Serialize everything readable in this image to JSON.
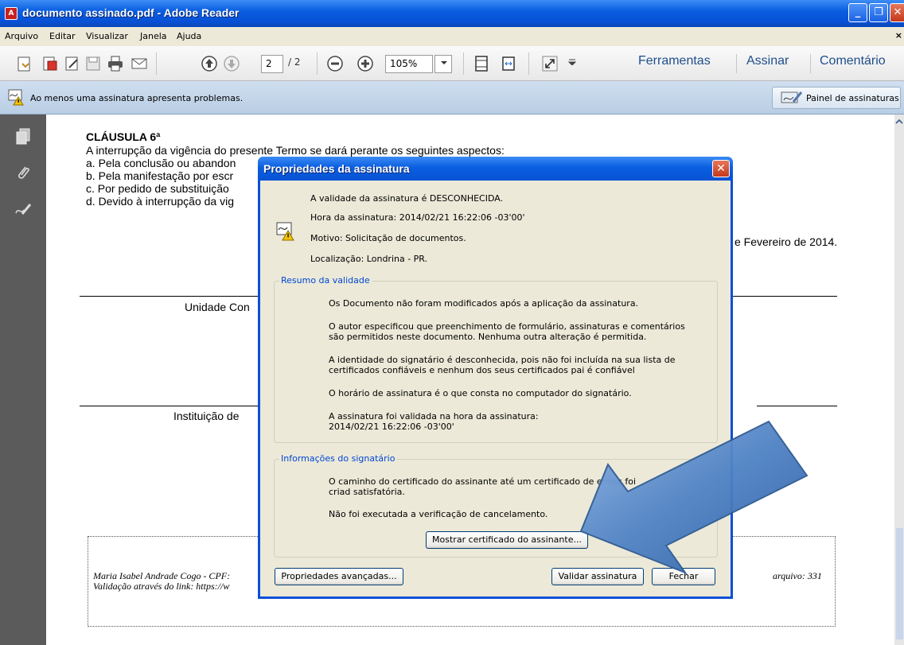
{
  "window": {
    "title": "documento assinado.pdf - Adobe Reader",
    "app_icon_glyph": "A",
    "min_glyph": "_",
    "max_glyph": "❐",
    "close_glyph": "✕"
  },
  "menu": {
    "items": [
      "Arquivo",
      "Editar",
      "Visualizar",
      "Janela",
      "Ajuda"
    ],
    "close_glyph": "×"
  },
  "toolbar": {
    "page_current": "2",
    "page_total": "/ 2",
    "zoom": "105%",
    "links": [
      "Ferramentas",
      "Assinar",
      "Comentário"
    ]
  },
  "infobar": {
    "message": "Ao menos uma assinatura apresenta problemas.",
    "panel_button": "Painel de assinaturas"
  },
  "document": {
    "clause_title": "CLÁUSULA 6ª",
    "intro": "A interrupção da vigência do presente Termo se dará perante os seguintes aspectos:",
    "items": [
      "a.  Pela conclusão ou abandon",
      "b.  Pela manifestação por escr",
      "c.  Por pedido de substituição",
      "d.  Devido à interrupção da vig"
    ],
    "date_fragment": "e Fevereiro de 2014.",
    "unit_label": "Unidade Con",
    "institution_label": "Instituição de",
    "footer_line1_left": "Maria Isabel Andrade Cogo - CPF:",
    "footer_line1_right": "arquivo: 331",
    "footer_line2_left": "Validação através do link: https://w"
  },
  "dialog": {
    "title": "Propriedades da assinatura",
    "close_glyph": "✕",
    "validity": "A validade da assinatura é DESCONHECIDA.",
    "time": "Hora da assinatura:  2014/02/21 16:22:06 -03'00'",
    "reason": "Motivo: Solicitação de documentos.",
    "location": "Localização:  Londrina - PR.",
    "summary": {
      "label": "Resumo da validade",
      "lines": [
        "Os Documento não foram modificados após a aplicação da assinatura.",
        "O autor especificou que preenchimento de formulário, assinaturas e comentários são permitidos neste documento. Nenhuma outra alteração é permitida.",
        "A identidade do signatário é desconhecida, pois não foi incluída na sua lista de certificados confiáveis e nenhum dos seus certificados pai é confiável",
        "O horário de assinatura é o que consta no computador do signatário.",
        "A assinatura foi validada na hora da assinatura:\n2014/02/21 16:22:06 -03'00'"
      ]
    },
    "signer": {
      "label": "Informações do signatário",
      "lines": [
        "O caminho do certificado do assinante até um certificado de emiss   foi criad satisfatória.",
        "Não foi executada a verificação de cancelamento."
      ],
      "show_cert_button": "Mostrar certificado do assinante..."
    },
    "buttons": {
      "advanced": "Propriedades avançadas...",
      "validate": "Validar assinatura",
      "close": "Fechar"
    }
  },
  "colors": {
    "titlebar": "#0a5ee0",
    "arrow_fill": "#4f82c4",
    "group_label": "#0046d5"
  }
}
